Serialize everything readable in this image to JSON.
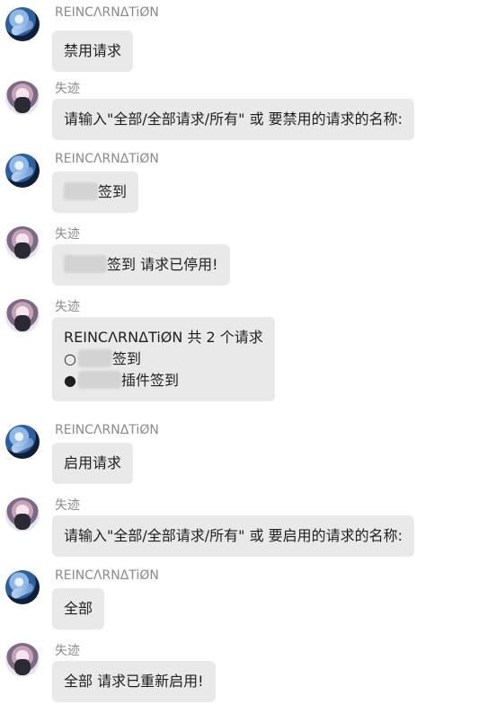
{
  "messages": [
    {
      "sender": "REINCΛRNΔTiØN",
      "role": "user",
      "lines": [
        "禁用请求"
      ]
    },
    {
      "sender": "失迹",
      "role": "bot",
      "lines": [
        "请输入\"全部/全部请求/所有\" 或 要禁用的请求的名称:"
      ]
    },
    {
      "sender": "REINCΛRNΔTiØN",
      "role": "user",
      "lines": [
        "签到"
      ]
    },
    {
      "sender": "失迹",
      "role": "bot",
      "lines": [
        "签到 请求已停用!"
      ]
    },
    {
      "sender": "失迹",
      "role": "bot",
      "lines": [
        "REINCΛRNΔTiØN 共 2 个请求",
        "签到",
        "插件签到"
      ],
      "bullets": [
        "○",
        "●"
      ]
    },
    {
      "sender": "REINCΛRNΔTiØN",
      "role": "user",
      "lines": [
        "启用请求"
      ]
    },
    {
      "sender": "失迹",
      "role": "bot",
      "lines": [
        "请输入\"全部/全部请求/所有\" 或 要启用的请求的名称:"
      ]
    },
    {
      "sender": "REINCΛRNΔTiØN",
      "role": "user",
      "lines": [
        "全部"
      ]
    },
    {
      "sender": "失迹",
      "role": "bot",
      "lines": [
        "全部 请求已重新启用!"
      ]
    }
  ]
}
